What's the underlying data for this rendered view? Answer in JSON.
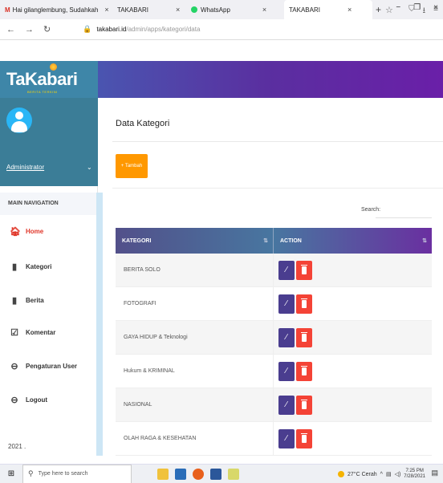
{
  "browser": {
    "tabs": [
      {
        "label": "Hai gilanglembung, Sudahkah ",
        "prefix": "M",
        "icon": "gmail-icon"
      },
      {
        "label": "TAKABARI",
        "icon": "none"
      },
      {
        "label": "WhatsApp",
        "icon": "whatsapp-icon"
      },
      {
        "label": "TAKABARI",
        "icon": "none"
      }
    ],
    "url_host": "takabari.id",
    "url_path": "/admin/apps/kategori/data"
  },
  "brand": {
    "logo_text": "TaKabari",
    "logo_sub": "BERITA TERKINI"
  },
  "sidebar": {
    "username": "Administrator",
    "nav_header": "MAIN NAVIGATION",
    "items": [
      {
        "label": "Home",
        "icon": "home-icon",
        "active": true
      },
      {
        "label": "Kategori",
        "icon": "book-icon"
      },
      {
        "label": "Berita",
        "icon": "book-icon"
      },
      {
        "label": "Komentar",
        "icon": "check-square-icon"
      },
      {
        "label": "Pengaturan User",
        "icon": "user-circle-icon"
      },
      {
        "label": "Logout",
        "icon": "user-circle-icon"
      }
    ],
    "footer": "2021 ."
  },
  "main": {
    "title": "Data Kategori",
    "add_button": "+ Tambah",
    "search_label": "Search:",
    "columns": [
      "KATEGORI",
      "ACTION"
    ],
    "rows": [
      "BERITA SOLO",
      "FOTOGRAFI",
      "GAYA HIDUP & Teknologi",
      "Hukum & KRIMINAL",
      "NASIONAL",
      "OLAH RAGA & KESEHATAN"
    ]
  },
  "taskbar": {
    "search_placeholder": "Type here to search",
    "weather": "27°C Cerah",
    "time": "7:25 PM",
    "date": "7/28/2021"
  },
  "colors": {
    "accent_orange": "#ff9800",
    "edit_purple": "#4a3d8f",
    "delete_red": "#f44336",
    "sidebar_teal": "#3b7d97"
  }
}
